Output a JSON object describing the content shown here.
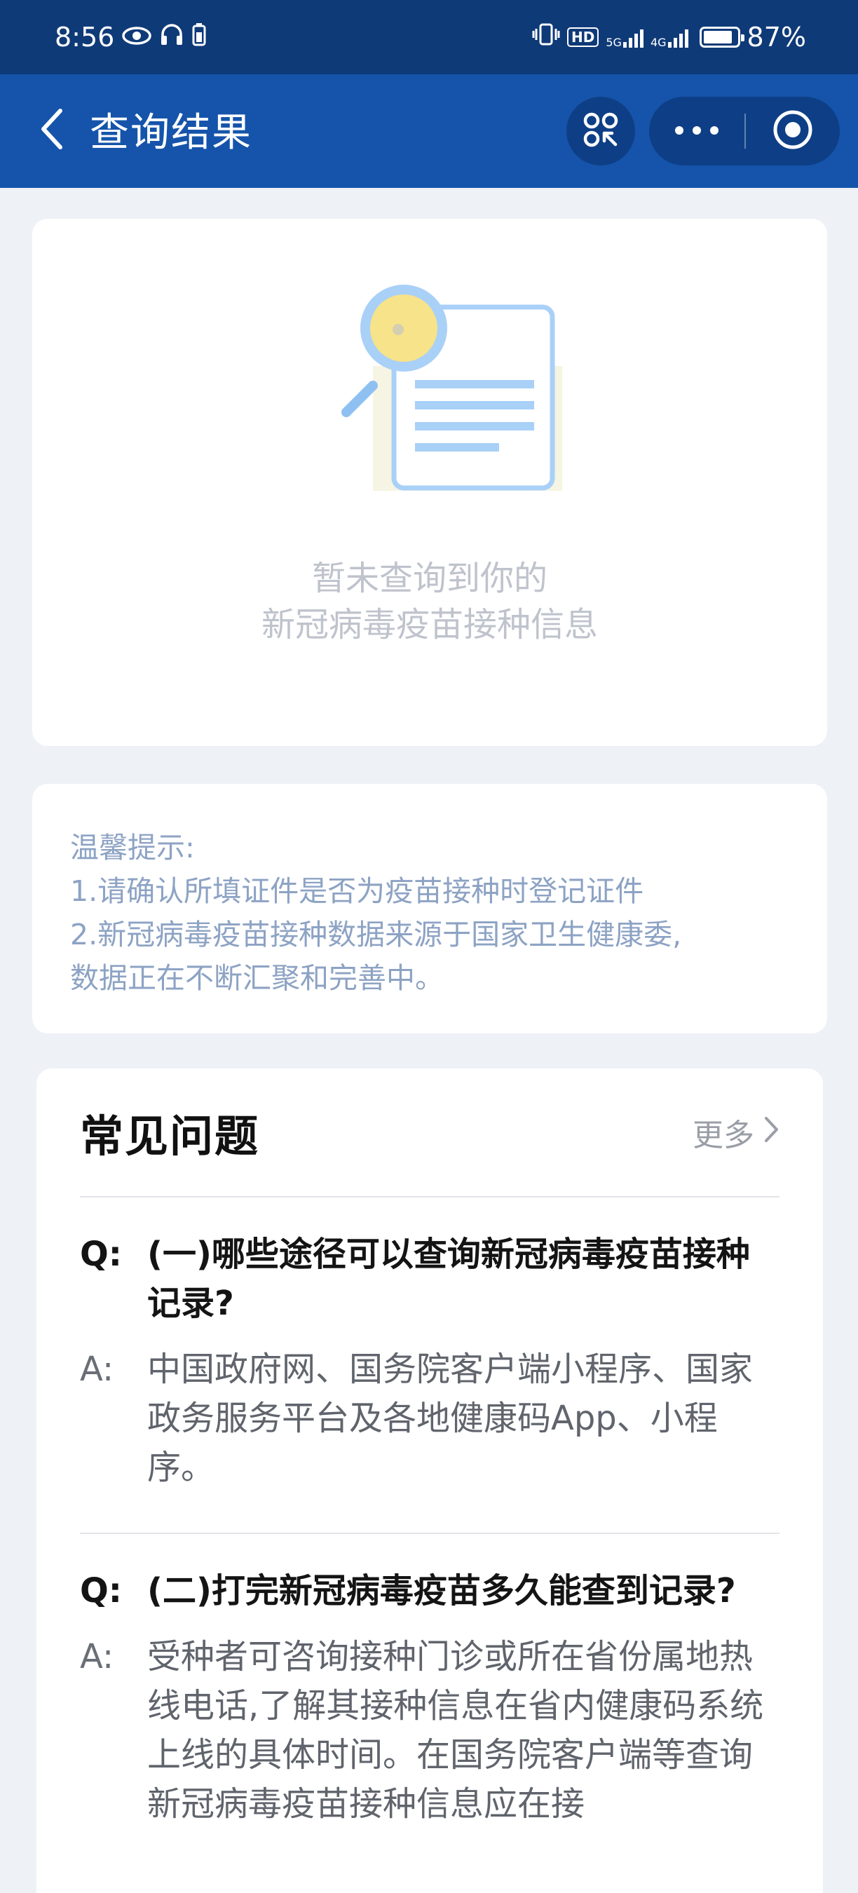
{
  "status_bar": {
    "time": "8:56",
    "left_icons": [
      "eye-icon",
      "headphones-icon",
      "battery-saver-icon"
    ],
    "right_icons": [
      "vibrate-icon",
      "hd-icon",
      "signal-5g-icon",
      "signal-4g-icon",
      "battery-icon"
    ],
    "hd_label": "HD",
    "net1_label": "5G",
    "net2_label": "4G",
    "battery_percent": "87%",
    "battery_level": 0.87
  },
  "nav": {
    "title": "查询结果",
    "back_icon": "chevron-left-icon",
    "scan_icon": "scan-icon",
    "more_icon": "more-dots-icon",
    "close_icon": "target-icon"
  },
  "result": {
    "illustration_icon": "magnifier-document-icon",
    "empty_line1": "暂未查询到你的",
    "empty_line2": "新冠病毒疫苗接种信息"
  },
  "tips": {
    "title": "温馨提示:",
    "line1": "1.请确认所填证件是否为疫苗接种时登记证件",
    "line2": "2.新冠病毒疫苗接种数据来源于国家卫生健康委,",
    "line3": "数据正在不断汇聚和完善中。"
  },
  "faq": {
    "title": "常见问题",
    "more_label": "更多",
    "more_icon": "chevron-right-icon",
    "q_prefix": "Q:",
    "a_prefix": "A:",
    "items": [
      {
        "question": "(一)哪些途径可以查询新冠病毒疫苗接种记录?",
        "answer": "中国政府网、国务院客户端小程序、国家政务服务平台及各地健康码App、小程序。"
      },
      {
        "question": "(二)打完新冠病毒疫苗多久能查到记录?",
        "answer": "受种者可咨询接种门诊或所在省份属地热线电话,了解其接种信息在省内健康码系统上线的具体时间。在国务院客户端等查询新冠病毒疫苗接种信息应在接"
      }
    ]
  },
  "colors": {
    "status_bar": "#0f3a78",
    "nav_bar": "#1554aa",
    "page_bg": "#eef1f6",
    "tip_text": "#8da3c4"
  }
}
